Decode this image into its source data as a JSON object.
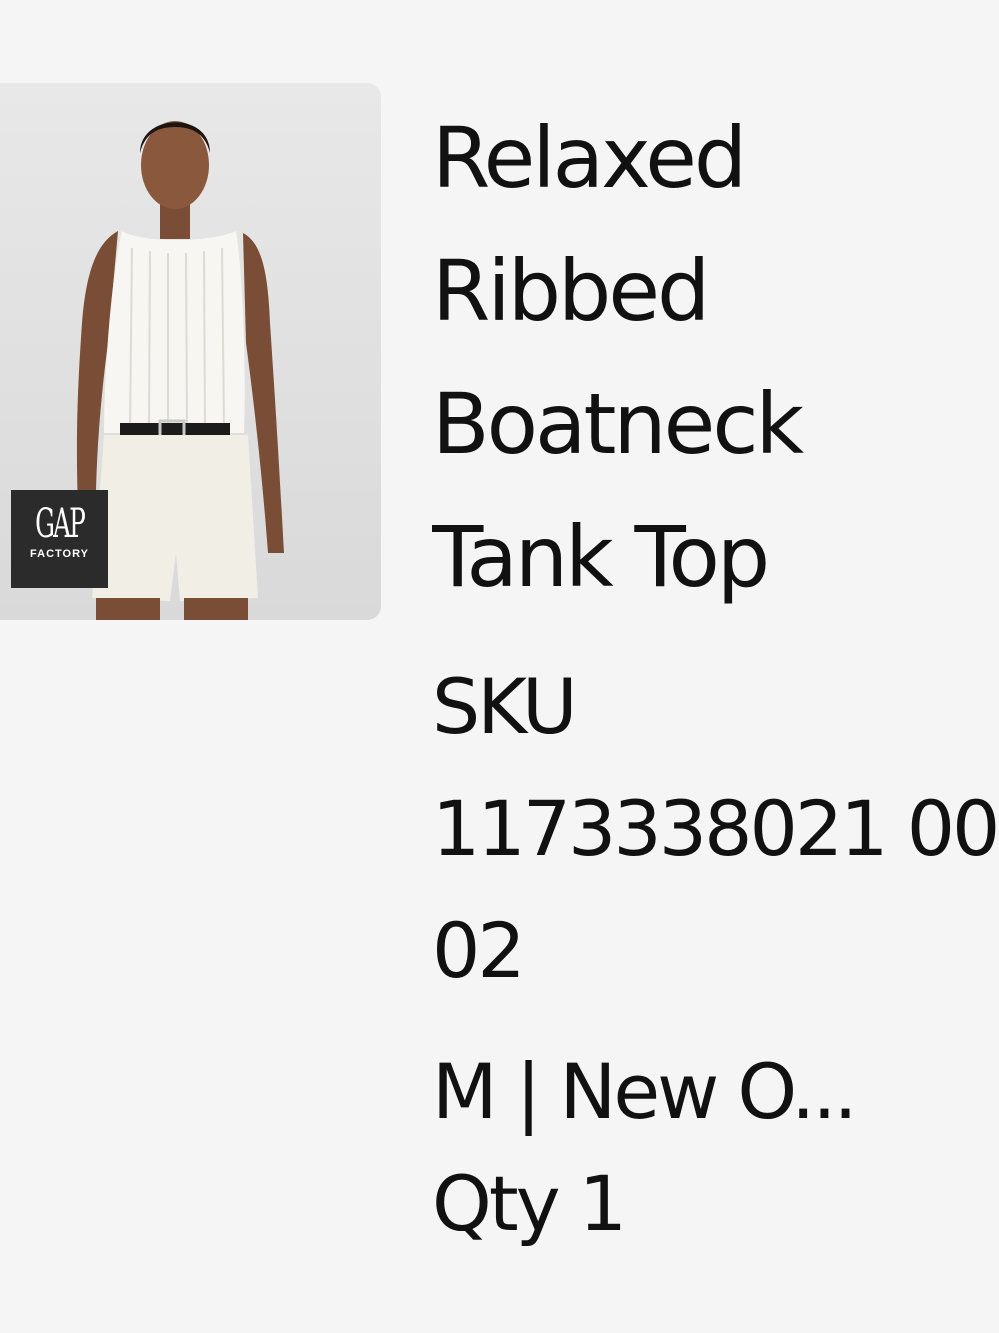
{
  "product": {
    "title": "Relaxed Ribbed Boatneck Tank Top",
    "sku_label": "SKU",
    "sku_value": "1173338021 0002",
    "variant": "M | New O...",
    "quantity": "Qty 1",
    "image_alt": "Model wearing white ribbed sleeveless tank top with white shorts and black belt"
  },
  "brand": {
    "name": "GAP",
    "sub": "FACTORY"
  },
  "colors": {
    "background": "#f5f5f5",
    "text": "#111111",
    "badge": "#2b2b2b",
    "image_bg": "#e3e3e3"
  }
}
